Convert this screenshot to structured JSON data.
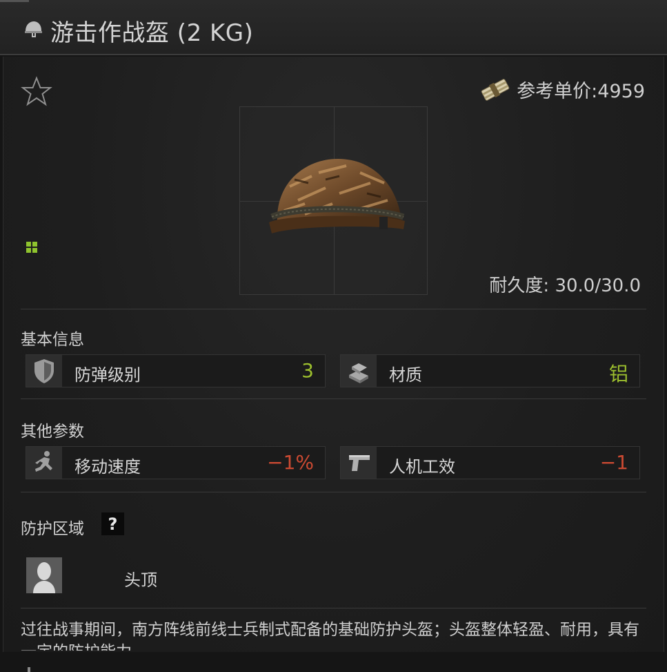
{
  "title": "游击作战盔 (2 KG)",
  "price": {
    "label": "参考单价:4959"
  },
  "durability": "耐久度: 30.0/30.0",
  "basic_info": {
    "title": "基本信息",
    "stats": [
      {
        "label": "防弹级别",
        "value": "3",
        "icon": "shield-icon",
        "color": "#9cbf2e"
      },
      {
        "label": "材质",
        "value": "铝",
        "icon": "aluminum-ingots-icon",
        "color": "#9cbf2e"
      }
    ]
  },
  "other_params": {
    "title": "其他参数",
    "stats": [
      {
        "label": "移动速度",
        "value": "−1%",
        "icon": "running-soldier-icon",
        "color": "#cc4a32"
      },
      {
        "label": "人机工效",
        "value": "−1",
        "icon": "pistol-icon",
        "color": "#cc4a32"
      }
    ]
  },
  "protection": {
    "title": "防护区域",
    "help": "?",
    "zones": [
      {
        "label": "头顶",
        "icon": "head-silhouette-icon"
      }
    ]
  },
  "description": "过往战事期间，南方阵线前线士兵制式配备的基础防护头盔；头盔整体轻盈、耐用，具有一定的防护能力。"
}
